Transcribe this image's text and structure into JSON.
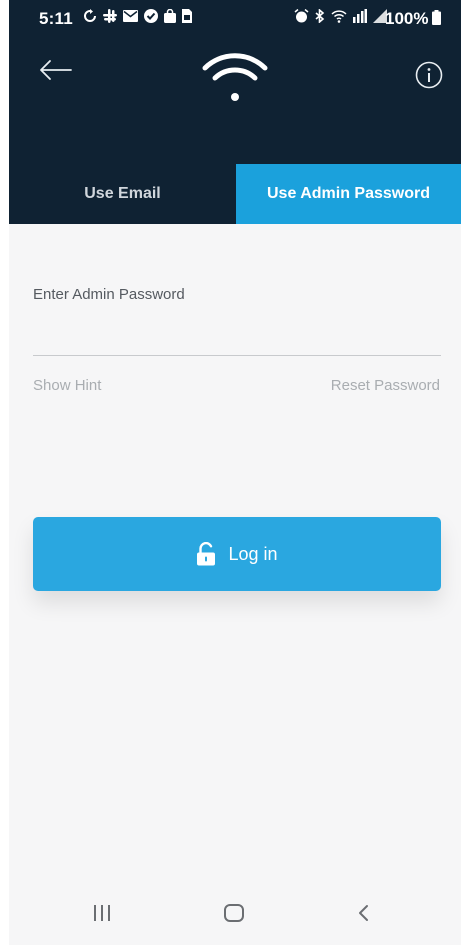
{
  "status_bar": {
    "time": "5:11",
    "battery_text": "100%",
    "left_icons": [
      "sync-icon",
      "slack-icon",
      "mail-icon",
      "check-circle-icon",
      "bag-icon",
      "sim-icon"
    ],
    "right_icons": [
      "alarm-icon",
      "bluetooth-icon",
      "wifi-calling-icon",
      "lte-signal-icon",
      "signal-icon",
      "battery-icon"
    ]
  },
  "header": {
    "back_icon": "arrow-left-icon",
    "logo_icon": "wifi-icon",
    "info_icon": "info-icon"
  },
  "tabs": [
    {
      "label": "Use Email",
      "active": false
    },
    {
      "label": "Use Admin Password",
      "active": true
    }
  ],
  "form": {
    "password_label": "Enter Admin Password",
    "password_value": "",
    "show_hint": "Show Hint",
    "reset_password": "Reset Password"
  },
  "login": {
    "label": "Log in",
    "icon": "unlock-icon"
  },
  "nav": {
    "recent_icon": "recent-apps-icon",
    "home_icon": "home-icon",
    "back_icon": "back-icon"
  },
  "colors": {
    "header_bg": "#0f2233",
    "accent": "#1ba1dc",
    "button": "#2aa7e0",
    "page_bg": "#f6f6f7"
  }
}
